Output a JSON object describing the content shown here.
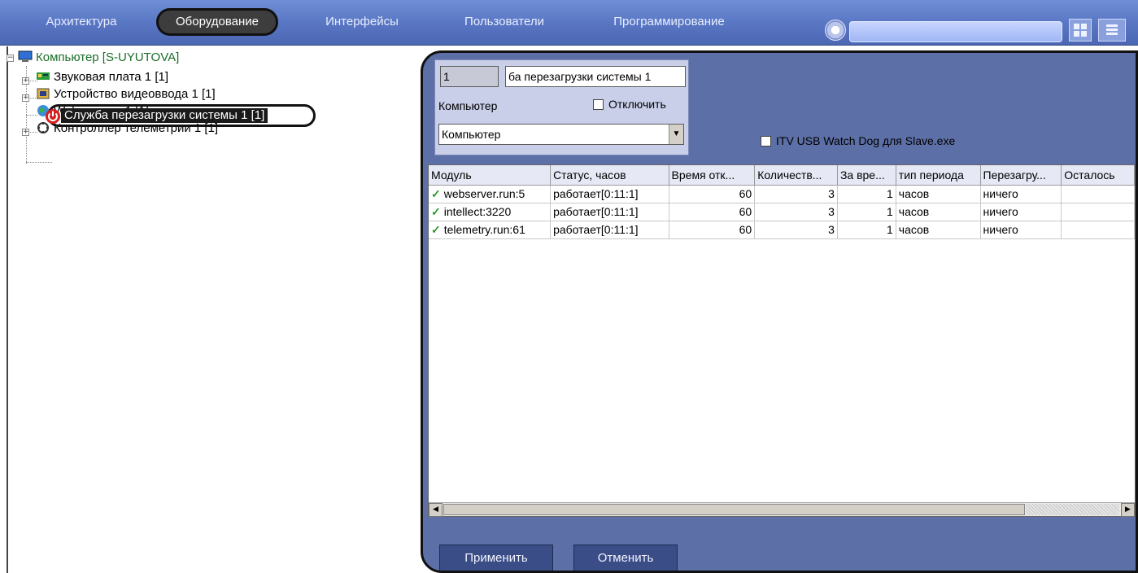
{
  "topbar": {
    "tabs": [
      {
        "label": "Архитектура"
      },
      {
        "label": "Оборудование"
      },
      {
        "label": "Интерфейсы"
      },
      {
        "label": "Пользователи"
      },
      {
        "label": "Программирование"
      }
    ],
    "active_tab": "Оборудование",
    "search_value": ""
  },
  "tree": {
    "root": "Компьютер [S-UYUTOVA]",
    "items": [
      {
        "label": "Звуковая плата 1 [1]",
        "icon": "sound-card-icon"
      },
      {
        "label": "Устройство видеоввода 1 [1]",
        "icon": "video-input-icon"
      },
      {
        "label": "Web сервер 1 [1]",
        "icon": "globe-icon"
      },
      {
        "label": "Контроллер телеметрии 1 [1]",
        "icon": "telemetry-icon"
      },
      {
        "label": "Служба перезагрузки системы 1 [1]",
        "icon": "power-icon"
      }
    ]
  },
  "settings": {
    "id_value": "1",
    "name_value": "ба перезагрузки системы 1",
    "computer_label": "Компьютер",
    "disable_label": "Отключить",
    "computer_select": "Компьютер",
    "itv_label": "ITV USB Watch Dog для Slave.exe"
  },
  "table": {
    "columns": [
      "Модуль",
      "Статус, часов",
      "Время отк...",
      "Количеств...",
      "За вре...",
      "тип периода",
      "Перезагру...",
      "Осталось"
    ],
    "rows": [
      {
        "module": "webserver.run:5",
        "status": "работает[0:11:1]",
        "time": "60",
        "count": "3",
        "period": "1",
        "type": "часов",
        "reboot": "ничего",
        "left": ""
      },
      {
        "module": "intellect:3220",
        "status": "работает[0:11:1]",
        "time": "60",
        "count": "3",
        "period": "1",
        "type": "часов",
        "reboot": "ничего",
        "left": ""
      },
      {
        "module": "telemetry.run:61",
        "status": "работает[0:11:1]",
        "time": "60",
        "count": "3",
        "period": "1",
        "type": "часов",
        "reboot": "ничего",
        "left": ""
      }
    ]
  },
  "buttons": {
    "apply": "Применить",
    "cancel": "Отменить"
  },
  "colors": {
    "topbar": "#5a77c4",
    "panel": "#5c6fa6",
    "accent_green": "#2a9a2a",
    "power_red": "#d62020"
  }
}
